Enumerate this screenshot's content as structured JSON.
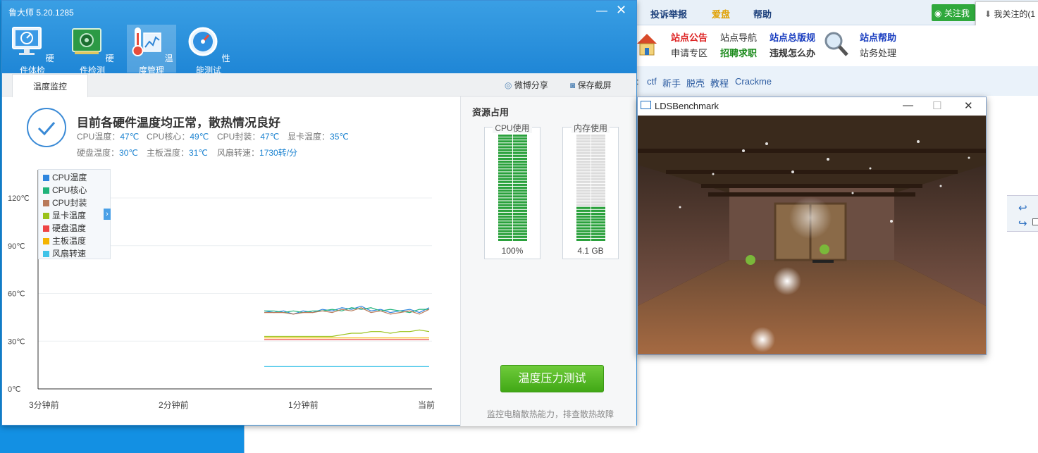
{
  "app": {
    "title": "鲁大师 5.20.1285",
    "toolbar": [
      {
        "label": "硬件体检",
        "icon": "monitor-icon"
      },
      {
        "label": "硬件检测",
        "icon": "circuit-board-icon"
      },
      {
        "label": "温度管理",
        "icon": "thermometer-icon"
      },
      {
        "label": "性能测试",
        "icon": "speedometer-icon"
      }
    ],
    "tab": "温度监控",
    "share_label": "微博分享",
    "screenshot_label": "保存截屏",
    "headline": "目前各硬件温度均正常，散热情况良好",
    "stats": {
      "cpu_temp_label": "CPU温度：",
      "cpu_temp": "47℃",
      "cpu_core_label": "CPU核心：",
      "cpu_core": "49℃",
      "cpu_pkg_label": "CPU封装：",
      "cpu_pkg": "47℃",
      "gpu_label": "显卡温度：",
      "gpu": "35℃",
      "disk_label": "硬盘温度：",
      "disk": "30℃",
      "board_label": "主板温度：",
      "board": "31℃",
      "fan_label": "风扇转速：",
      "fan": "1730转/分"
    },
    "legend": [
      {
        "label": "CPU温度",
        "color": "#2e86de"
      },
      {
        "label": "CPU核心",
        "color": "#1fb37a"
      },
      {
        "label": "CPU封装",
        "color": "#b97a5a"
      },
      {
        "label": "显卡温度",
        "color": "#9ac21a"
      },
      {
        "label": "硬盘温度",
        "color": "#ee4444"
      },
      {
        "label": "主板温度",
        "color": "#f4b400"
      },
      {
        "label": "风扇转速",
        "color": "#3fc3e8"
      }
    ],
    "resources": {
      "title": "资源占用",
      "cpu_label": "CPU使用",
      "cpu_value": "100%",
      "cpu_fraction": 1.0,
      "mem_label": "内存使用",
      "mem_value": "4.1 GB",
      "mem_fraction": 0.32
    },
    "stress_button": "温度压力测试",
    "hint": "监控电脑散热能力，排查散热故障"
  },
  "chart_data": {
    "type": "line",
    "ylabel": "",
    "y_ticks": [
      "0℃",
      "30℃",
      "60℃",
      "90℃",
      "120℃"
    ],
    "ylim": [
      0,
      120
    ],
    "x_ticks": [
      "3分钟前",
      "2分钟前",
      "1分钟前",
      "当前"
    ],
    "series": [
      {
        "name": "CPU温度",
        "values": [
          49,
          48,
          49,
          47,
          49,
          48,
          50,
          49,
          51,
          50,
          52,
          49,
          50,
          48,
          49,
          50,
          48,
          51
        ]
      },
      {
        "name": "CPU核心",
        "values": [
          49,
          49,
          48,
          49,
          48,
          49,
          49,
          50,
          49,
          51,
          50,
          51,
          49,
          50,
          49,
          48,
          50,
          50
        ]
      },
      {
        "name": "CPU封装",
        "values": [
          48,
          48,
          48,
          47,
          48,
          48,
          49,
          48,
          50,
          49,
          51,
          48,
          49,
          47,
          48,
          49,
          47,
          50
        ]
      },
      {
        "name": "显卡温度",
        "values": [
          33,
          33,
          33,
          33,
          33,
          33,
          33,
          33,
          34,
          35,
          35,
          36,
          36,
          35,
          36,
          36,
          37,
          36
        ]
      },
      {
        "name": "硬盘温度",
        "values": [
          31,
          31,
          31,
          31,
          31,
          31,
          31,
          31,
          31,
          31,
          31,
          31,
          31,
          31,
          31,
          31,
          31,
          31
        ]
      },
      {
        "name": "主板温度",
        "values": [
          32,
          32,
          32,
          32,
          32,
          32,
          32,
          32,
          32,
          32,
          32,
          32,
          32,
          32,
          32,
          32,
          32,
          32
        ]
      },
      {
        "name": "风扇转速",
        "values": [
          14,
          14,
          14,
          14,
          14,
          14,
          14,
          14,
          14,
          14,
          14,
          14,
          14,
          14,
          14,
          14,
          14,
          14
        ]
      }
    ]
  },
  "browser": {
    "nav": [
      "投诉举报",
      "爱盘",
      "帮助"
    ],
    "wechat_label": "关注我",
    "dropdown": "我关注的(1",
    "links": {
      "a1": "站点公告",
      "a2": "申请专区",
      "b1": "站点导航",
      "b2": "招聘求职",
      "c1": "站点总版规",
      "c2": "违规怎么办",
      "d1": "站点帮助",
      "d2": "站务处理"
    },
    "tags_prefix": ":",
    "tags": [
      "ctf",
      "新手",
      "脱壳",
      "教程",
      "Crackme"
    ]
  },
  "lds": {
    "title": "LDSBenchmark"
  }
}
